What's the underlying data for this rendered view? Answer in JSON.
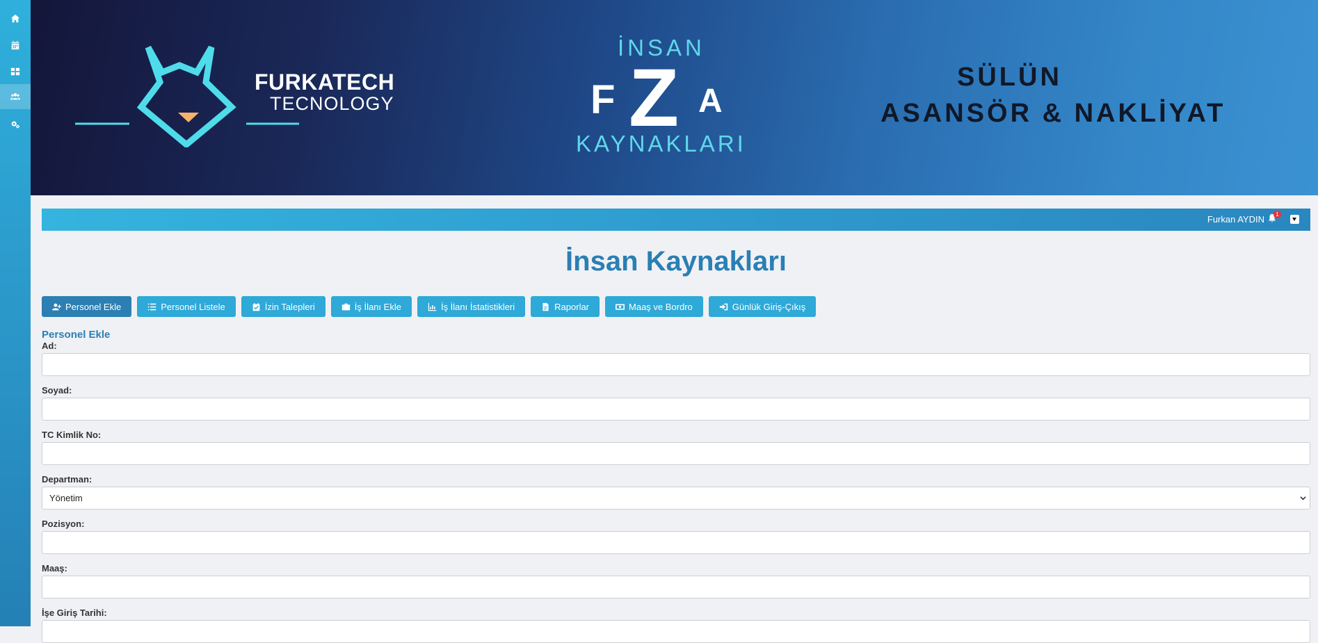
{
  "sidebar": {
    "items": [
      {
        "icon": "home-icon"
      },
      {
        "icon": "calendar-icon"
      },
      {
        "icon": "dashboard-grid-icon"
      },
      {
        "icon": "users-icon",
        "active": true
      },
      {
        "icon": "gears-icon"
      }
    ]
  },
  "banner": {
    "brand_name": "FURKATECH",
    "brand_sub": "TECNOLOGY",
    "ik_top": "İNSAN",
    "ik_f": "F",
    "ik_z": "Z",
    "ik_a": "A",
    "ik_bottom": "KAYNAKLARI",
    "company_line1": "SÜLÜN",
    "company_line2": "ASANSÖR & NAKLİYAT",
    "accent_color": "#5fd7ea"
  },
  "topbar": {
    "user_name": "Furkan AYDIN",
    "notification_count": "1"
  },
  "page": {
    "title": "İnsan Kaynakları"
  },
  "actions": [
    {
      "label": "Personel Ekle",
      "icon": "user-plus-icon",
      "style": "light"
    },
    {
      "label": "Personel Listele",
      "icon": "list-icon",
      "style": "cyan"
    },
    {
      "label": "İzin Talepleri",
      "icon": "calendar-check-icon",
      "style": "cyan"
    },
    {
      "label": "İş İlanı Ekle",
      "icon": "briefcase-icon",
      "style": "cyan"
    },
    {
      "label": "İş İlanı İstatistikleri",
      "icon": "chart-icon",
      "style": "cyan"
    },
    {
      "label": "Raporlar",
      "icon": "file-icon",
      "style": "cyan"
    },
    {
      "label": "Maaş ve Bordro",
      "icon": "money-icon",
      "style": "cyan"
    },
    {
      "label": "Günlük Giriş-Çıkış",
      "icon": "sign-in-icon",
      "style": "cyan"
    }
  ],
  "form": {
    "section_title": "Personel Ekle",
    "fields": [
      {
        "label": "Ad:",
        "value": ""
      },
      {
        "label": "Soyad:",
        "value": ""
      },
      {
        "label": "TC Kimlik No:",
        "value": ""
      },
      {
        "label": "Departman:",
        "value": "Yönetim"
      },
      {
        "label": "Pozisyon:",
        "value": ""
      },
      {
        "label": "Maaş:",
        "value": ""
      },
      {
        "label": "İşe Giriş Tarihi:",
        "value": ""
      }
    ]
  }
}
